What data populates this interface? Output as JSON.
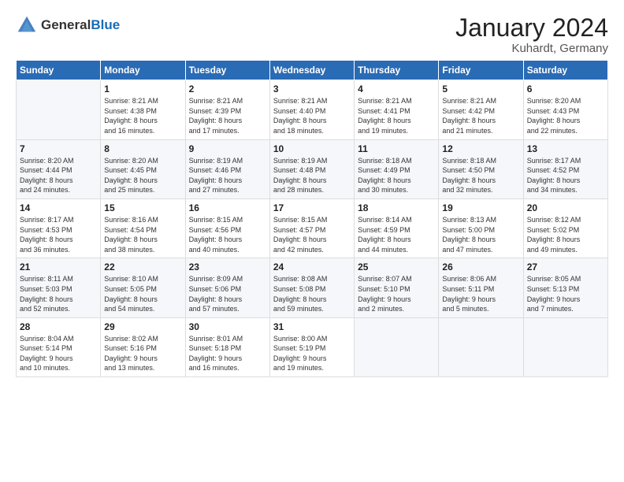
{
  "logo": {
    "general": "General",
    "blue": "Blue"
  },
  "title": "January 2024",
  "subtitle": "Kuhardt, Germany",
  "headers": [
    "Sunday",
    "Monday",
    "Tuesday",
    "Wednesday",
    "Thursday",
    "Friday",
    "Saturday"
  ],
  "weeks": [
    [
      {
        "day": "",
        "sunrise": "",
        "sunset": "",
        "daylight": ""
      },
      {
        "day": "1",
        "sunrise": "Sunrise: 8:21 AM",
        "sunset": "Sunset: 4:38 PM",
        "daylight": "Daylight: 8 hours and 16 minutes."
      },
      {
        "day": "2",
        "sunrise": "Sunrise: 8:21 AM",
        "sunset": "Sunset: 4:39 PM",
        "daylight": "Daylight: 8 hours and 17 minutes."
      },
      {
        "day": "3",
        "sunrise": "Sunrise: 8:21 AM",
        "sunset": "Sunset: 4:40 PM",
        "daylight": "Daylight: 8 hours and 18 minutes."
      },
      {
        "day": "4",
        "sunrise": "Sunrise: 8:21 AM",
        "sunset": "Sunset: 4:41 PM",
        "daylight": "Daylight: 8 hours and 19 minutes."
      },
      {
        "day": "5",
        "sunrise": "Sunrise: 8:21 AM",
        "sunset": "Sunset: 4:42 PM",
        "daylight": "Daylight: 8 hours and 21 minutes."
      },
      {
        "day": "6",
        "sunrise": "Sunrise: 8:20 AM",
        "sunset": "Sunset: 4:43 PM",
        "daylight": "Daylight: 8 hours and 22 minutes."
      }
    ],
    [
      {
        "day": "7",
        "sunrise": "Sunrise: 8:20 AM",
        "sunset": "Sunset: 4:44 PM",
        "daylight": "Daylight: 8 hours and 24 minutes."
      },
      {
        "day": "8",
        "sunrise": "Sunrise: 8:20 AM",
        "sunset": "Sunset: 4:45 PM",
        "daylight": "Daylight: 8 hours and 25 minutes."
      },
      {
        "day": "9",
        "sunrise": "Sunrise: 8:19 AM",
        "sunset": "Sunset: 4:46 PM",
        "daylight": "Daylight: 8 hours and 27 minutes."
      },
      {
        "day": "10",
        "sunrise": "Sunrise: 8:19 AM",
        "sunset": "Sunset: 4:48 PM",
        "daylight": "Daylight: 8 hours and 28 minutes."
      },
      {
        "day": "11",
        "sunrise": "Sunrise: 8:18 AM",
        "sunset": "Sunset: 4:49 PM",
        "daylight": "Daylight: 8 hours and 30 minutes."
      },
      {
        "day": "12",
        "sunrise": "Sunrise: 8:18 AM",
        "sunset": "Sunset: 4:50 PM",
        "daylight": "Daylight: 8 hours and 32 minutes."
      },
      {
        "day": "13",
        "sunrise": "Sunrise: 8:17 AM",
        "sunset": "Sunset: 4:52 PM",
        "daylight": "Daylight: 8 hours and 34 minutes."
      }
    ],
    [
      {
        "day": "14",
        "sunrise": "Sunrise: 8:17 AM",
        "sunset": "Sunset: 4:53 PM",
        "daylight": "Daylight: 8 hours and 36 minutes."
      },
      {
        "day": "15",
        "sunrise": "Sunrise: 8:16 AM",
        "sunset": "Sunset: 4:54 PM",
        "daylight": "Daylight: 8 hours and 38 minutes."
      },
      {
        "day": "16",
        "sunrise": "Sunrise: 8:15 AM",
        "sunset": "Sunset: 4:56 PM",
        "daylight": "Daylight: 8 hours and 40 minutes."
      },
      {
        "day": "17",
        "sunrise": "Sunrise: 8:15 AM",
        "sunset": "Sunset: 4:57 PM",
        "daylight": "Daylight: 8 hours and 42 minutes."
      },
      {
        "day": "18",
        "sunrise": "Sunrise: 8:14 AM",
        "sunset": "Sunset: 4:59 PM",
        "daylight": "Daylight: 8 hours and 44 minutes."
      },
      {
        "day": "19",
        "sunrise": "Sunrise: 8:13 AM",
        "sunset": "Sunset: 5:00 PM",
        "daylight": "Daylight: 8 hours and 47 minutes."
      },
      {
        "day": "20",
        "sunrise": "Sunrise: 8:12 AM",
        "sunset": "Sunset: 5:02 PM",
        "daylight": "Daylight: 8 hours and 49 minutes."
      }
    ],
    [
      {
        "day": "21",
        "sunrise": "Sunrise: 8:11 AM",
        "sunset": "Sunset: 5:03 PM",
        "daylight": "Daylight: 8 hours and 52 minutes."
      },
      {
        "day": "22",
        "sunrise": "Sunrise: 8:10 AM",
        "sunset": "Sunset: 5:05 PM",
        "daylight": "Daylight: 8 hours and 54 minutes."
      },
      {
        "day": "23",
        "sunrise": "Sunrise: 8:09 AM",
        "sunset": "Sunset: 5:06 PM",
        "daylight": "Daylight: 8 hours and 57 minutes."
      },
      {
        "day": "24",
        "sunrise": "Sunrise: 8:08 AM",
        "sunset": "Sunset: 5:08 PM",
        "daylight": "Daylight: 8 hours and 59 minutes."
      },
      {
        "day": "25",
        "sunrise": "Sunrise: 8:07 AM",
        "sunset": "Sunset: 5:10 PM",
        "daylight": "Daylight: 9 hours and 2 minutes."
      },
      {
        "day": "26",
        "sunrise": "Sunrise: 8:06 AM",
        "sunset": "Sunset: 5:11 PM",
        "daylight": "Daylight: 9 hours and 5 minutes."
      },
      {
        "day": "27",
        "sunrise": "Sunrise: 8:05 AM",
        "sunset": "Sunset: 5:13 PM",
        "daylight": "Daylight: 9 hours and 7 minutes."
      }
    ],
    [
      {
        "day": "28",
        "sunrise": "Sunrise: 8:04 AM",
        "sunset": "Sunset: 5:14 PM",
        "daylight": "Daylight: 9 hours and 10 minutes."
      },
      {
        "day": "29",
        "sunrise": "Sunrise: 8:02 AM",
        "sunset": "Sunset: 5:16 PM",
        "daylight": "Daylight: 9 hours and 13 minutes."
      },
      {
        "day": "30",
        "sunrise": "Sunrise: 8:01 AM",
        "sunset": "Sunset: 5:18 PM",
        "daylight": "Daylight: 9 hours and 16 minutes."
      },
      {
        "day": "31",
        "sunrise": "Sunrise: 8:00 AM",
        "sunset": "Sunset: 5:19 PM",
        "daylight": "Daylight: 9 hours and 19 minutes."
      },
      {
        "day": "",
        "sunrise": "",
        "sunset": "",
        "daylight": ""
      },
      {
        "day": "",
        "sunrise": "",
        "sunset": "",
        "daylight": ""
      },
      {
        "day": "",
        "sunrise": "",
        "sunset": "",
        "daylight": ""
      }
    ]
  ]
}
